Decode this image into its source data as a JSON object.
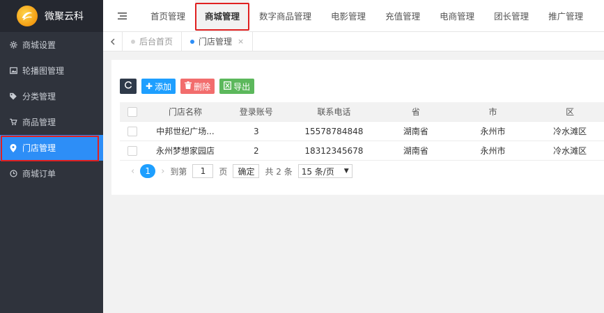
{
  "app": {
    "title": "微聚云科"
  },
  "sidebar": {
    "items": [
      {
        "label": "商城设置",
        "icon": "gear-icon"
      },
      {
        "label": "轮播图管理",
        "icon": "image-icon"
      },
      {
        "label": "分类管理",
        "icon": "tag-icon"
      },
      {
        "label": "商品管理",
        "icon": "cart-icon"
      },
      {
        "label": "门店管理",
        "icon": "map-pin-icon",
        "active": true
      },
      {
        "label": "商城订单",
        "icon": "clock-icon"
      }
    ]
  },
  "topnav": {
    "tabs": [
      "首页管理",
      "商城管理",
      "数字商品管理",
      "电影管理",
      "充值管理",
      "电商管理",
      "团长管理",
      "推广管理"
    ],
    "active": "商城管理"
  },
  "tabstrip": {
    "tabs": [
      {
        "label": "后台首页",
        "active": false
      },
      {
        "label": "门店管理",
        "active": true
      }
    ],
    "close": "×"
  },
  "toolbar": {
    "add_label": "添加",
    "delete_label": "删除",
    "export_label": "导出"
  },
  "table": {
    "headers": [
      "门店名称",
      "登录账号",
      "联系电话",
      "省",
      "市",
      "区"
    ],
    "rows": [
      [
        "中邦世纪广场...",
        "3",
        "15578784848",
        "湖南省",
        "永州市",
        "冷水滩区"
      ],
      [
        "永州梦想家园店",
        "2",
        "18312345678",
        "湖南省",
        "永州市",
        "冷水滩区"
      ]
    ]
  },
  "pager": {
    "current_page": "1",
    "goto_label": "到第",
    "page_input": "1",
    "page_unit": "页",
    "confirm_label": "确定",
    "total_label": "共 2 条",
    "page_size": "15 条/页"
  },
  "colors": {
    "sidebar_bg": "#2f333c",
    "accent": "#2d8ef7",
    "highlight": "#e02020"
  }
}
